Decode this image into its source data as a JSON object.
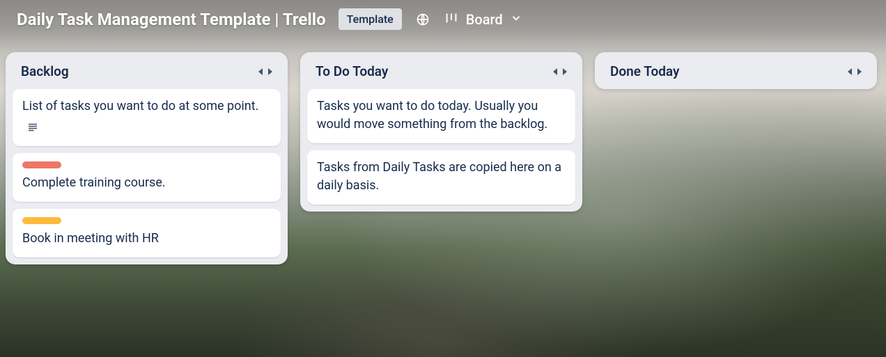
{
  "header": {
    "title": "Daily Task Management Template | Trello",
    "template_badge": "Template",
    "view_label": "Board"
  },
  "lists": [
    {
      "title": "Backlog",
      "cards": [
        {
          "text": "List of tasks you want to do at some point.",
          "has_description": true
        },
        {
          "text": "Complete training course.",
          "label_color": "#ef7564"
        },
        {
          "text": "Book in meeting with HR",
          "label_color": "#fdba3b"
        }
      ]
    },
    {
      "title": "To Do Today",
      "cards": [
        {
          "text": "Tasks you want to do today. Usually you would move something from the backlog."
        },
        {
          "text": "Tasks from Daily Tasks are copied here on a daily basis."
        }
      ]
    },
    {
      "title": "Done Today",
      "cards": []
    }
  ]
}
